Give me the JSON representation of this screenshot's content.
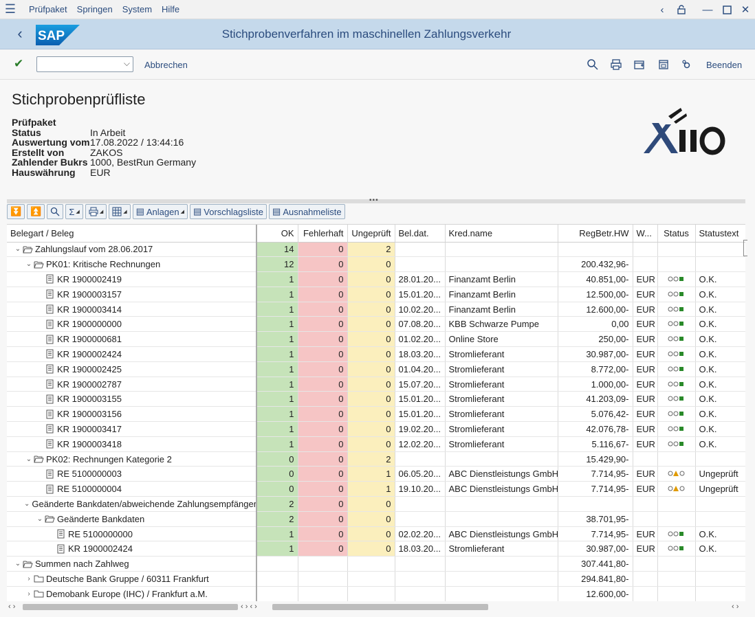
{
  "menu": [
    "Prüfpaket",
    "Springen",
    "System",
    "Hilfe"
  ],
  "title": "Stichprobenverfahren im maschinellen Zahlungsverkehr",
  "toolbar": {
    "cancel": "Abbrechen",
    "exit": "Beenden",
    "command": ""
  },
  "header": {
    "title": "Stichprobenprüfliste",
    "section": "Prüfpaket",
    "fields": [
      {
        "label": "Status",
        "value": "In Arbeit"
      },
      {
        "label": "Auswertung vom",
        "value": "17.08.2022 / 13:44:16"
      },
      {
        "label": "Erstellt von",
        "value": "ZAKOS"
      },
      {
        "label": "Zahlender Bukrs",
        "value": "1000, BestRun Germany"
      },
      {
        "label": "Hauswährung",
        "value": "EUR"
      }
    ]
  },
  "buttons": {
    "anlagen": "Anlagen",
    "vorschlag": "Vorschlagsliste",
    "ausnahme": "Ausnahmeliste"
  },
  "columns": [
    "Belegart / Beleg",
    "OK",
    "Fehlerhaft",
    "Ungeprüft",
    "Bel.dat.",
    "Kred.name",
    "RegBetr.HW",
    "W...",
    "Status",
    "Statustext"
  ],
  "rows": [
    {
      "level": 0,
      "type": "folder-open",
      "label": "Zahlungslauf vom 28.06.2017",
      "ok": "14",
      "fe": "0",
      "un": "2",
      "date": "",
      "kred": "",
      "amt": "",
      "cur": "",
      "status": "",
      "text": ""
    },
    {
      "level": 1,
      "type": "folder-open",
      "label": "PK01: Kritische Rechnungen",
      "ok": "12",
      "fe": "0",
      "un": "0",
      "date": "",
      "kred": "",
      "amt": "200.432,96-",
      "cur": "",
      "status": "",
      "text": ""
    },
    {
      "level": 2,
      "type": "doc",
      "label": "KR 1900002419",
      "ok": "1",
      "fe": "0",
      "un": "0",
      "date": "28.01.20...",
      "kred": "Finanzamt Berlin",
      "amt": "40.851,00-",
      "cur": "EUR",
      "status": "ok",
      "text": "O.K."
    },
    {
      "level": 2,
      "type": "doc",
      "label": "KR 1900003157",
      "ok": "1",
      "fe": "0",
      "un": "0",
      "date": "15.01.20...",
      "kred": "Finanzamt Berlin",
      "amt": "12.500,00-",
      "cur": "EUR",
      "status": "ok",
      "text": "O.K."
    },
    {
      "level": 2,
      "type": "doc",
      "label": "KR 1900003414",
      "ok": "1",
      "fe": "0",
      "un": "0",
      "date": "10.02.20...",
      "kred": "Finanzamt Berlin",
      "amt": "12.600,00-",
      "cur": "EUR",
      "status": "ok",
      "text": "O.K."
    },
    {
      "level": 2,
      "type": "doc",
      "label": "KR 1900000000",
      "ok": "1",
      "fe": "0",
      "un": "0",
      "date": "07.08.20...",
      "kred": "KBB Schwarze Pumpe",
      "amt": "0,00",
      "cur": "EUR",
      "status": "ok",
      "text": "O.K."
    },
    {
      "level": 2,
      "type": "doc",
      "label": "KR 1900000681",
      "ok": "1",
      "fe": "0",
      "un": "0",
      "date": "01.02.20...",
      "kred": "Online Store",
      "amt": "250,00-",
      "cur": "EUR",
      "status": "ok",
      "text": "O.K."
    },
    {
      "level": 2,
      "type": "doc",
      "label": "KR 1900002424",
      "ok": "1",
      "fe": "0",
      "un": "0",
      "date": "18.03.20...",
      "kred": "Stromlieferant",
      "amt": "30.987,00-",
      "cur": "EUR",
      "status": "ok",
      "text": "O.K."
    },
    {
      "level": 2,
      "type": "doc",
      "label": "KR 1900002425",
      "ok": "1",
      "fe": "0",
      "un": "0",
      "date": "01.04.20...",
      "kred": "Stromlieferant",
      "amt": "8.772,00-",
      "cur": "EUR",
      "status": "ok",
      "text": "O.K."
    },
    {
      "level": 2,
      "type": "doc",
      "label": "KR 1900002787",
      "ok": "1",
      "fe": "0",
      "un": "0",
      "date": "15.07.20...",
      "kred": "Stromlieferant",
      "amt": "1.000,00-",
      "cur": "EUR",
      "status": "ok",
      "text": "O.K."
    },
    {
      "level": 2,
      "type": "doc",
      "label": "KR 1900003155",
      "ok": "1",
      "fe": "0",
      "un": "0",
      "date": "15.01.20...",
      "kred": "Stromlieferant",
      "amt": "41.203,09-",
      "cur": "EUR",
      "status": "ok",
      "text": "O.K."
    },
    {
      "level": 2,
      "type": "doc",
      "label": "KR 1900003156",
      "ok": "1",
      "fe": "0",
      "un": "0",
      "date": "15.01.20...",
      "kred": "Stromlieferant",
      "amt": "5.076,42-",
      "cur": "EUR",
      "status": "ok",
      "text": "O.K."
    },
    {
      "level": 2,
      "type": "doc",
      "label": "KR 1900003417",
      "ok": "1",
      "fe": "0",
      "un": "0",
      "date": "19.02.20...",
      "kred": "Stromlieferant",
      "amt": "42.076,78-",
      "cur": "EUR",
      "status": "ok",
      "text": "O.K."
    },
    {
      "level": 2,
      "type": "doc",
      "label": "KR 1900003418",
      "ok": "1",
      "fe": "0",
      "un": "0",
      "date": "12.02.20...",
      "kred": "Stromlieferant",
      "amt": "5.116,67-",
      "cur": "EUR",
      "status": "ok",
      "text": "O.K."
    },
    {
      "level": 1,
      "type": "folder-open",
      "label": "PK02: Rechnungen Kategorie 2",
      "ok": "0",
      "fe": "0",
      "un": "2",
      "date": "",
      "kred": "",
      "amt": "15.429,90-",
      "cur": "",
      "status": "",
      "text": ""
    },
    {
      "level": 2,
      "type": "doc",
      "label": "RE 5100000003",
      "ok": "0",
      "fe": "0",
      "un": "1",
      "date": "06.05.20...",
      "kred": "ABC Dienstleistungs GmbH",
      "amt": "7.714,95-",
      "cur": "EUR",
      "status": "warn",
      "text": "Ungeprüft"
    },
    {
      "level": 2,
      "type": "doc",
      "label": "RE 5100000004",
      "ok": "0",
      "fe": "0",
      "un": "1",
      "date": "19.10.20...",
      "kred": "ABC Dienstleistungs GmbH",
      "amt": "7.714,95-",
      "cur": "EUR",
      "status": "warn",
      "text": "Ungeprüft"
    },
    {
      "level": 1,
      "type": "folder-open",
      "label": "Geänderte Bankdaten/abweichende Zahlungsempfänger",
      "ok": "2",
      "fe": "0",
      "un": "0",
      "date": "",
      "kred": "",
      "amt": "",
      "cur": "",
      "status": "",
      "text": ""
    },
    {
      "level": 2,
      "type": "folder-open",
      "label": "Geänderte Bankdaten",
      "ok": "2",
      "fe": "0",
      "un": "0",
      "date": "",
      "kred": "",
      "amt": "38.701,95-",
      "cur": "",
      "status": "",
      "text": ""
    },
    {
      "level": 3,
      "type": "doc",
      "label": "RE 5100000000",
      "ok": "1",
      "fe": "0",
      "un": "0",
      "date": "02.02.20...",
      "kred": "ABC Dienstleistungs GmbH",
      "amt": "7.714,95-",
      "cur": "EUR",
      "status": "ok",
      "text": "O.K."
    },
    {
      "level": 3,
      "type": "doc",
      "label": "KR 1900002424",
      "ok": "1",
      "fe": "0",
      "un": "0",
      "date": "18.03.20...",
      "kred": "Stromlieferant",
      "amt": "30.987,00-",
      "cur": "EUR",
      "status": "ok",
      "text": "O.K."
    },
    {
      "level": 0,
      "type": "folder-open",
      "label": "Summen nach Zahlweg",
      "ok": "",
      "fe": "",
      "un": "",
      "date": "",
      "kred": "",
      "amt": "307.441,80-",
      "cur": "",
      "status": "",
      "text": "",
      "plain": true
    },
    {
      "level": 1,
      "type": "folder-closed",
      "label": "Deutsche Bank Gruppe / 60311 Frankfurt",
      "ok": "",
      "fe": "",
      "un": "",
      "date": "",
      "kred": "",
      "amt": "294.841,80-",
      "cur": "",
      "status": "",
      "text": "",
      "plain": true
    },
    {
      "level": 1,
      "type": "folder-closed",
      "label": "Demobank Europe (IHC) / Frankfurt a.M.",
      "ok": "",
      "fe": "",
      "un": "",
      "date": "",
      "kred": "",
      "amt": "12.600,00-",
      "cur": "",
      "status": "",
      "text": "",
      "plain": true
    }
  ]
}
